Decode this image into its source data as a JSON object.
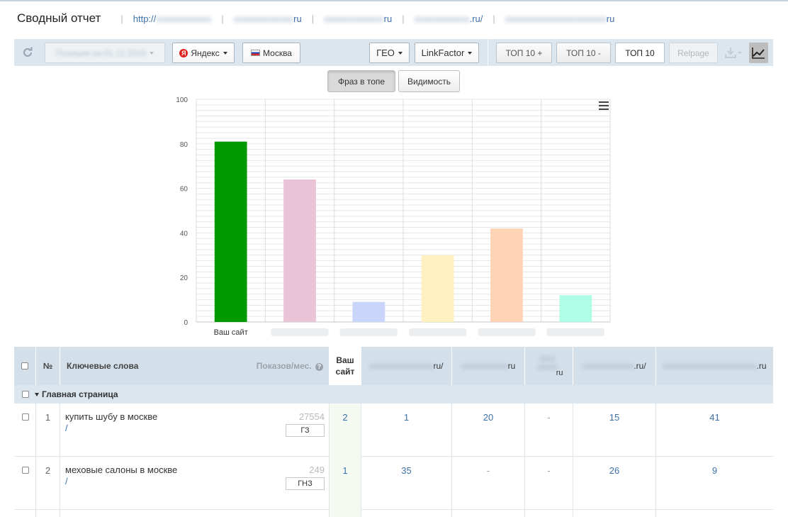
{
  "header": {
    "title": "Сводный отчет",
    "sites": [
      {
        "prefix": "http://",
        "suffix": ""
      },
      {
        "prefix": "",
        "suffix": "ru"
      },
      {
        "prefix": "",
        "suffix": "ru"
      },
      {
        "prefix": "",
        "suffix": ".ru/"
      },
      {
        "prefix": "",
        "suffix": "ru"
      }
    ]
  },
  "toolbar": {
    "date_select": "Позиции на 01.12.2015",
    "search_engine": "Яндекс",
    "region": "Москва",
    "geo": "ГЕО",
    "linkfactor": "LinkFactor",
    "top_plus": "ТОП 10 +",
    "top_minus": "ТОП 10 -",
    "top": "ТОП 10",
    "relpage": "Relpage"
  },
  "chart_tabs": {
    "phrases": "Фраз в топе",
    "visibility": "Видимость"
  },
  "chart_data": {
    "type": "bar",
    "categories": [
      "Ваш сайт",
      "",
      "",
      "",
      "",
      ""
    ],
    "values": [
      81,
      64,
      9,
      30,
      42,
      12
    ],
    "colors": [
      "#009900",
      "#e9c3d6",
      "#c9d5fb",
      "#fff1c0",
      "#ffd3b6",
      "#aefde6"
    ],
    "ylim": [
      0,
      100
    ],
    "yticks": [
      0,
      20,
      40,
      60,
      80,
      100
    ],
    "grid": true,
    "legend": "none"
  },
  "table": {
    "headers": {
      "num": "№",
      "keywords": "Ключевые слова",
      "impressions": "Показов/мес.",
      "your_site": "Ваш сайт",
      "competitors": [
        "ru/",
        "ru",
        "ru",
        ".ru/",
        ".ru"
      ]
    },
    "group": "Главная страница",
    "rows": [
      {
        "n": "1",
        "keyword": "купить шубу в москве",
        "url": "/",
        "freq": "27554",
        "badge": "ГЗ",
        "your": "2",
        "comp": [
          "1",
          "20",
          "-",
          "15",
          "41"
        ]
      },
      {
        "n": "2",
        "keyword": "меховые салоны в москве",
        "url": "/",
        "freq": "249",
        "badge": "ГНЗ",
        "your": "1",
        "comp": [
          "35",
          "-",
          "-",
          "26",
          "9"
        ]
      }
    ]
  }
}
